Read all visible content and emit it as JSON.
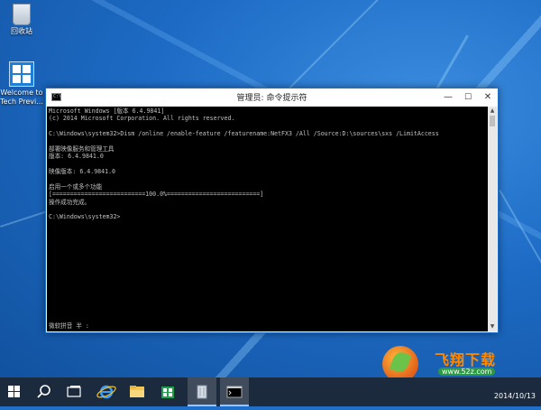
{
  "desktop": {
    "icons": [
      {
        "label": "回收站"
      },
      {
        "label_line1": "Welcome to",
        "label_line2": "Tech Previ..."
      }
    ]
  },
  "window": {
    "title": "管理员: 命令提示符",
    "minimize_glyph": "—",
    "maximize_glyph": "☐",
    "close_glyph": "✕",
    "console_lines": [
      "Microsoft Windows [版本 6.4.9841]",
      "(c) 2014 Microsoft Corporation. All rights reserved.",
      "",
      "C:\\Windows\\system32>Dism /online /enable-feature /featurename:NetFX3 /All /Source:D:\\sources\\sxs /LimitAccess",
      "",
      "部署映像服务和管理工具",
      "版本: 6.4.9841.0",
      "",
      "映像版本: 6.4.9841.0",
      "",
      "启用一个或多个功能",
      "[==========================100.0%==========================]",
      "操作成功完成。",
      "",
      "C:\\Windows\\system32>"
    ],
    "ime_status": "微软拼音 半 :",
    "scroll_up_glyph": "▲",
    "scroll_down_glyph": "▼"
  },
  "taskbar": {
    "start_icon": "windows-logo-icon",
    "items": [
      "search-icon",
      "task-view-icon",
      "internet-explorer-icon",
      "file-explorer-icon",
      "store-icon",
      "recycle-bin-app-icon",
      "command-prompt-icon"
    ],
    "clock_date": "2014/10/13"
  },
  "watermark": {
    "title": "飞翔下载",
    "url": "www.52z.com"
  },
  "colors": {
    "desktop_blue": "#1f6fc8",
    "console_bg": "#000000",
    "console_text": "#c0c0c0",
    "taskbar_bg": "#1c2a3d",
    "close_hover_red": "#e81123"
  }
}
